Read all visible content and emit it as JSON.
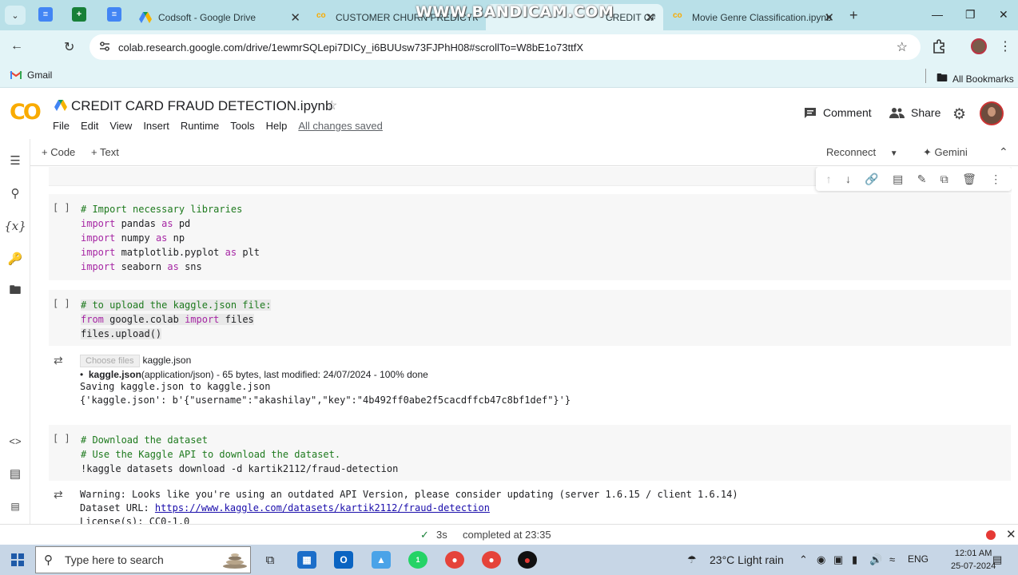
{
  "browser": {
    "tabs": [
      {
        "title": "Codsoft - Google Drive",
        "active": false
      },
      {
        "title": "CUSTOMER CHURN PREDICTION...",
        "active": false
      },
      {
        "title": "CREDIT CARD FRAUD DETECTION...",
        "active": true
      },
      {
        "title": "Movie Genre Classification.ipynb",
        "active": false
      }
    ],
    "watermark": "WWW.BANDICAM.COM",
    "url": "colab.research.google.com/drive/1ewmrSQLepi7DICy_i6BUUsw73FJPhH08#scrollTo=W8bE1o73ttfX",
    "bookmarks": {
      "gmail": "Gmail",
      "all": "All Bookmarks"
    }
  },
  "colab": {
    "notebook_title": "CREDIT CARD FRAUD DETECTION.ipynb",
    "menu": [
      "File",
      "Edit",
      "View",
      "Insert",
      "Runtime",
      "Tools",
      "Help"
    ],
    "save_status": "All changes saved",
    "comment_label": "Comment",
    "share_label": "Share",
    "add_code": "+ Code",
    "add_text": "+ Text",
    "reconnect_label": "Reconnect",
    "gemini_label": "Gemini"
  },
  "cells": {
    "run_label": "[ ]",
    "cell1": {
      "l1": "# Import necessary libraries",
      "l2a": "import",
      "l2b": " pandas ",
      "l2c": "as",
      "l2d": " pd",
      "l3a": "import",
      "l3b": " numpy ",
      "l3c": "as",
      "l3d": " np",
      "l4a": "import",
      "l4b": " matplotlib.pyplot ",
      "l4c": "as",
      "l4d": " plt",
      "l5a": "import",
      "l5b": " seaborn ",
      "l5c": "as",
      "l5d": " sns"
    },
    "cell2": {
      "l1": "# to upload the kaggle.json file:",
      "l2a": "from",
      "l2b": " google.colab ",
      "l2c": "import",
      "l2d": " files",
      "l3": "files.upload()"
    },
    "cell2_output": {
      "choose_files": "Choose files",
      "chosen": "kaggle.json",
      "bullet_name": "kaggle.json",
      "bullet_rest": "(application/json) - 65 bytes, last modified: 24/07/2024 - 100% done",
      "saving": "Saving kaggle.json to kaggle.json",
      "dict": "{'kaggle.json': b'{\"username\":\"akashilay\",\"key\":\"4b492ff0abe2f5cacdffcb47c8bf1def\"}'}"
    },
    "cell3": {
      "l1": "# Download the dataset",
      "l2": "# Use the Kaggle API to download the dataset.",
      "l3": "!kaggle datasets download -d kartik2112/fraud-detection"
    },
    "cell3_output": {
      "warning": "Warning: Looks like you're using an outdated API Version, please consider updating (server 1.6.15 / client 1.6.14)",
      "dataset_prefix": "Dataset URL: ",
      "dataset_url": "https://www.kaggle.com/datasets/kartik2112/fraud-detection",
      "license": "License(s): CC0-1.0"
    }
  },
  "status": {
    "duration": "3s",
    "completed": "completed at 23:35"
  },
  "taskbar": {
    "search_placeholder": "Type here to search",
    "weather": "23°C  Light rain",
    "lang": "ENG",
    "time": "12:01 AM",
    "date": "25-07-2024",
    "whatsapp_badge": "1"
  }
}
